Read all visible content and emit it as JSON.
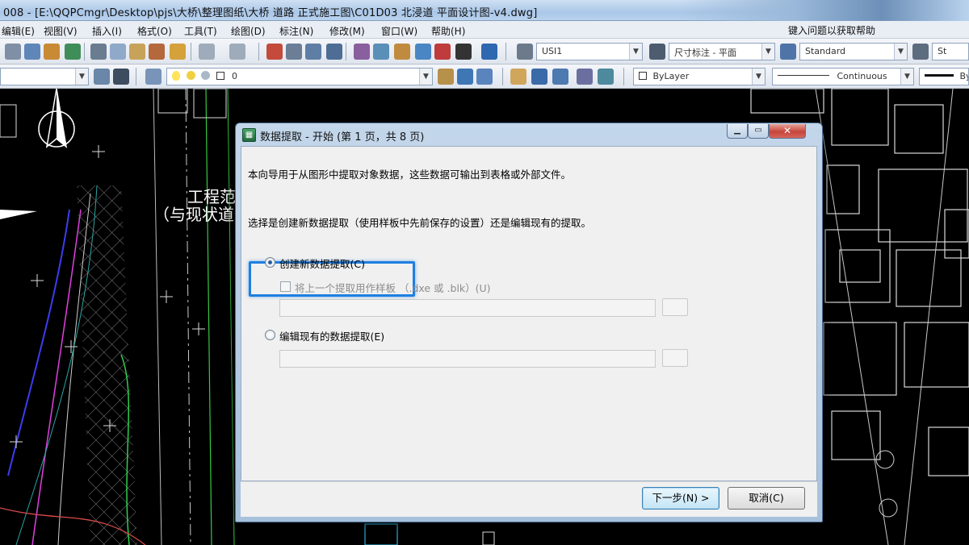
{
  "window": {
    "title": "008 - [E:\\QQPCmgr\\Desktop\\pjs\\大桥\\整理图纸\\大桥 道路 正式施工图\\C01D03 北浸道 平面设计图-v4.dwg]"
  },
  "menu": {
    "items": [
      "编辑(E)",
      "视图(V)",
      "插入(I)",
      "格式(O)",
      "工具(T)",
      "绘图(D)",
      "标注(N)",
      "修改(M)",
      "窗口(W)",
      "帮助(H)"
    ],
    "help_input": "键入问题以获取帮助"
  },
  "toolbar": {
    "text_style": "USI1",
    "dim_style": "尺寸标注 - 平面",
    "table_style": "Standard",
    "multileader_style": "St",
    "layer": "0",
    "color": "ByLayer",
    "linetype": "Continuous",
    "lineweight": "By"
  },
  "drawing": {
    "label_main": "工程范",
    "label_sub": "（与现状道路"
  },
  "dialog": {
    "title": "数据提取 - 开始 (第 1 页，共 8 页)",
    "intro": "本向导用于从图形中提取对象数据，这些数据可输出到表格或外部文件。",
    "question": "选择是创建新数据提取（使用样板中先前保存的设置）还是编辑现有的提取。",
    "option_create": "创建新数据提取(C)",
    "option_template": "将上一个提取用作样板 （.dxe 或 .blk）(U)",
    "option_edit": "编辑现有的数据提取(E)",
    "next_button": "下一步(N) >",
    "cancel_button": "取消(C)",
    "selected_option": "option_create"
  }
}
